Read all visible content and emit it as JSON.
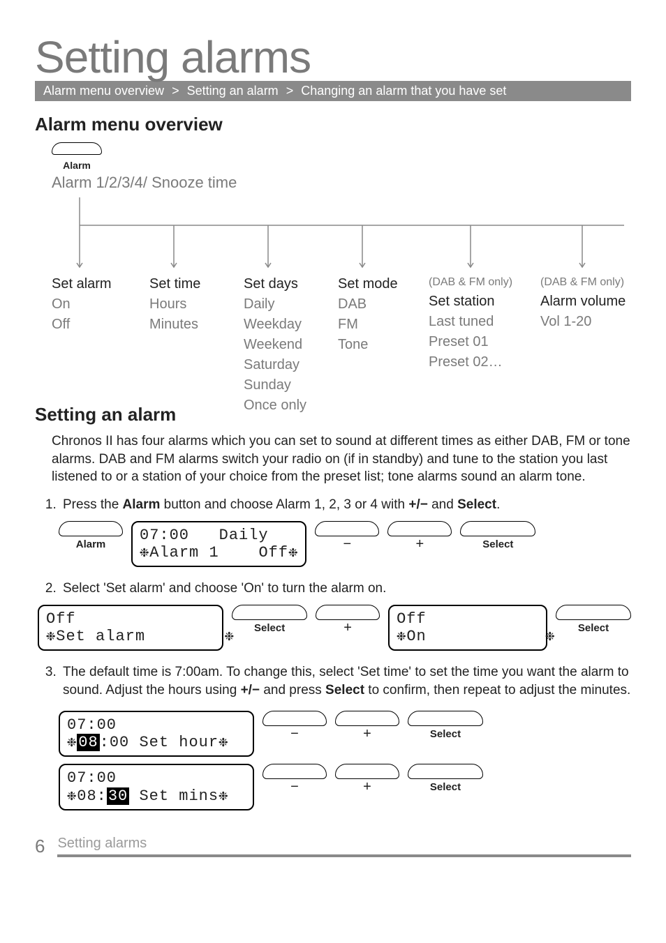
{
  "title": "Setting alarms",
  "breadcrumb": {
    "items": [
      "Alarm menu overview",
      "Setting an alarm",
      "Changing an alarm that you have set"
    ],
    "sep": ">"
  },
  "overview": {
    "heading": "Alarm menu overview",
    "button_label": "Alarm",
    "subtitle": "Alarm 1/2/3/4/ Snooze time",
    "columns": [
      {
        "title": "Set alarm",
        "items": [
          "On",
          "Off"
        ]
      },
      {
        "title": "Set time",
        "items": [
          "Hours",
          "Minutes"
        ]
      },
      {
        "title": "Set days",
        "items": [
          "Daily",
          "Weekday",
          "Weekend",
          "Saturday",
          "Sunday",
          "Once only"
        ]
      },
      {
        "title": "Set mode",
        "items": [
          "DAB",
          "FM",
          "Tone"
        ]
      },
      {
        "note": "(DAB & FM only)",
        "title": "Set station",
        "items": [
          "Last tuned",
          "Preset 01",
          "Preset 02…"
        ]
      },
      {
        "note": "(DAB & FM only)",
        "title": "Alarm volume",
        "items": [
          "Vol 1-20"
        ]
      }
    ]
  },
  "setting": {
    "heading": "Setting an alarm",
    "intro": "Chronos II has four alarms which you can set to sound at different times as either DAB, FM or tone alarms. DAB and FM alarms switch your radio on (if in standby) and tune to the station you last listened to or a station of your choice from the preset list; tone alarms sound an alarm tone.",
    "steps": [
      {
        "text_parts": [
          "Press the ",
          "Alarm",
          " button and choose Alarm 1, 2, 3 or 4 with  ",
          "+/−",
          "  and ",
          "Select",
          "."
        ],
        "display": {
          "line1": "07:00   Daily",
          "line2": "❉Alarm 1    Off❉"
        },
        "buttons": [
          "Alarm",
          "−",
          "+",
          "Select"
        ]
      },
      {
        "text_parts": [
          "Select 'Set alarm' and choose 'On' to turn the alarm on."
        ],
        "display_a": {
          "line1": "Off",
          "line2": "❉Set alarm        ❉"
        },
        "buttons_a": [
          "Select",
          "+"
        ],
        "display_b": {
          "line1": "Off",
          "line2": "❉On            ❉"
        },
        "buttons_b": [
          "Select"
        ]
      },
      {
        "text_parts": [
          "The default time is 7:00am. To change this, select 'Set time' to set the time you want the alarm to sound. Adjust the hours using  ",
          "+/−",
          " and press ",
          "Select",
          " to confirm, then repeat to adjust the minutes."
        ],
        "display_c": {
          "line1": "07:00",
          "line2_pre": "❉",
          "line2_hl": "08",
          "line2_post": ":00 Set hour❉"
        },
        "display_d": {
          "line1": "07:00",
          "line2_pre": "❉08:",
          "line2_hl": "30",
          "line2_post": " Set mins❉"
        },
        "buttons_cd": [
          "−",
          "+",
          "Select"
        ]
      }
    ]
  },
  "footer": {
    "page": "6",
    "title": "Setting alarms"
  },
  "glyphs": {
    "minus": "−",
    "plus": "+"
  }
}
